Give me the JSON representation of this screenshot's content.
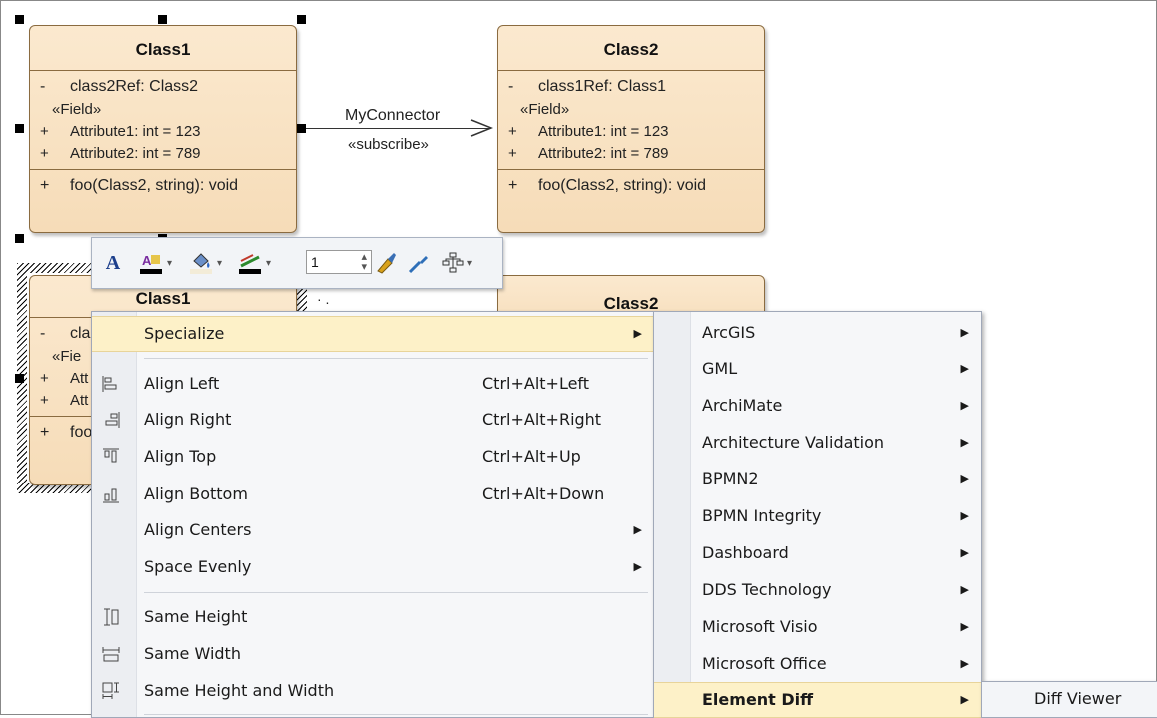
{
  "diagram": {
    "top_left": {
      "name": "Class1",
      "attr_ref": {
        "vis": "-",
        "text": "class2Ref: Class2"
      },
      "stereotype": "«Field»",
      "attrs": [
        {
          "vis": "+",
          "text": "Attribute1: int = 123"
        },
        {
          "vis": "+",
          "text": "Attribute2: int = 789"
        }
      ],
      "op": {
        "vis": "+",
        "text": "foo(Class2, string): void"
      }
    },
    "top_right": {
      "name": "Class2",
      "attr_ref": {
        "vis": "-",
        "text": "class1Ref: Class1"
      },
      "stereotype": "«Field»",
      "attrs": [
        {
          "vis": "+",
          "text": "Attribute1: int = 123"
        },
        {
          "vis": "+",
          "text": "Attribute2: int = 789"
        }
      ],
      "op": {
        "vis": "+",
        "text": "foo(Class2, string): void"
      }
    },
    "connector": {
      "name": "MyConnector",
      "stereotype": "«subscribe»"
    },
    "bottom_left": {
      "name": "Class1",
      "ref": "cla",
      "stereotype": "«Fie",
      "attr1": "Att",
      "attr2": "Att",
      "op": "foo",
      "vis_ref": "-",
      "vis1": "+",
      "vis2": "+",
      "vis_op": "+"
    },
    "bottom_right": {
      "name": "Class2"
    },
    "dots": "· ."
  },
  "toolbar": {
    "font_icon": "A",
    "line_width": "1",
    "icons": [
      "font-icon",
      "font-color-icon",
      "fill-color-icon",
      "line-color-icon",
      "line-width-spinner",
      "apply-style-icon",
      "get-style-icon",
      "layout-icon"
    ]
  },
  "context_menu": {
    "specialize": "Specialize",
    "items": [
      {
        "label": "Align Left",
        "shortcut": "Ctrl+Alt+Left"
      },
      {
        "label": "Align Right",
        "shortcut": "Ctrl+Alt+Right"
      },
      {
        "label": "Align Top",
        "shortcut": "Ctrl+Alt+Up"
      },
      {
        "label": "Align Bottom",
        "shortcut": "Ctrl+Alt+Down"
      },
      {
        "label": "Align Centers",
        "shortcut": ""
      },
      {
        "label": "Space Evenly",
        "shortcut": ""
      },
      {
        "label": "Same Height",
        "shortcut": ""
      },
      {
        "label": "Same Width",
        "shortcut": ""
      },
      {
        "label": "Same Height and Width",
        "shortcut": ""
      }
    ],
    "submenu_arrow": "▶"
  },
  "specialize_menu": {
    "items": [
      "ArcGIS",
      "GML",
      "ArchiMate",
      "Architecture Validation",
      "BPMN2",
      "BPMN Integrity",
      "Dashboard",
      "DDS Technology",
      "Microsoft Visio",
      "Microsoft Office",
      "Element Diff"
    ]
  },
  "element_diff_menu": {
    "items": [
      "Diff Viewer"
    ]
  }
}
